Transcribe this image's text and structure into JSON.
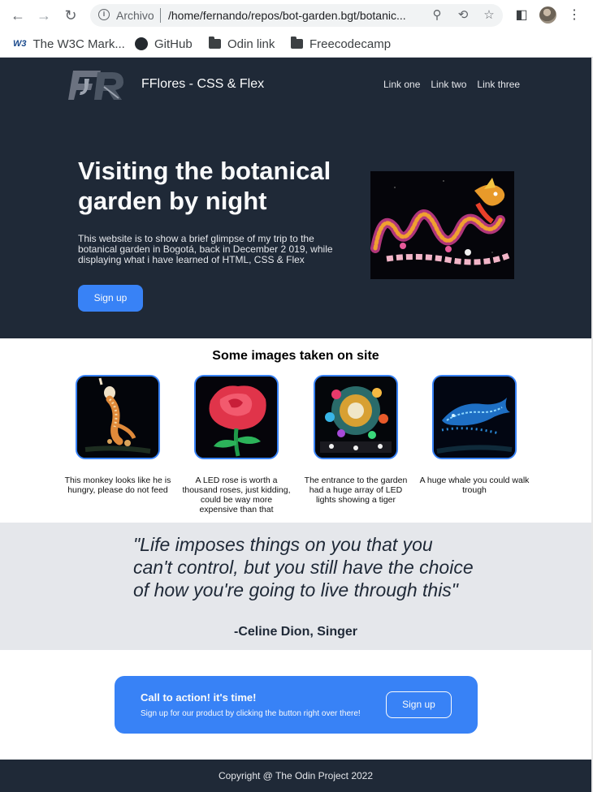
{
  "browser": {
    "scheme_label": "Archivo",
    "url": "/home/fernando/repos/bot-garden.bgt/botanic...",
    "bookmarks": [
      {
        "label": "The W3C Mark...",
        "icon": "w3c-icon"
      },
      {
        "label": "GitHub",
        "icon": "github-icon"
      },
      {
        "label": "Odin link",
        "icon": "folder-icon"
      },
      {
        "label": "Freecodecamp",
        "icon": "folder-icon"
      }
    ]
  },
  "header": {
    "site_title": "FFlores - CSS & Flex",
    "nav": [
      "Link one",
      "Link two",
      "Link three"
    ]
  },
  "hero": {
    "heading": "Visiting the botanical garden by night",
    "text": "This website is to show a brief glimpse of my trip to the botanical garden in Bogotá, back in December 2 019, while displaying what i have learned of HTML, CSS & Flex",
    "button_label": "Sign up"
  },
  "info": {
    "title": "Some images taken on site",
    "cards": [
      {
        "caption": "This monkey looks like he is hungry, please do not feed"
      },
      {
        "caption": "A LED rose is worth a thousand roses, just kidding, could be way more expensive than that"
      },
      {
        "caption": "The entrance to the garden had a huge array of LED lights showing a tiger"
      },
      {
        "caption": "A huge whale you could walk trough"
      }
    ]
  },
  "quote": {
    "text": "\"Life imposes things on you that you can't control, but you still have the choice of how you're going to live through this\"",
    "author": "-Celine Dion, Singer"
  },
  "cta": {
    "title": "Call to action! it's time!",
    "text": "Sign up for our product by clicking the button right over there!",
    "button_label": "Sign up"
  },
  "footer": {
    "text": "Copyright @ The Odin Project 2022"
  },
  "colors": {
    "dark": "#1f2937",
    "accent": "#3882f6",
    "light_band": "#e5e7eb"
  }
}
